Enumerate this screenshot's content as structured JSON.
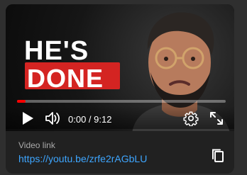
{
  "player": {
    "thumbnail": {
      "line1": "HE'S",
      "line2": "DONE",
      "accent_color": "#d42422"
    },
    "progress": {
      "fraction": 0.04,
      "color": "#ff0000"
    },
    "time": {
      "current": "0:00",
      "separator": " / ",
      "duration": "9:12",
      "display": "0:00 / 9:12"
    },
    "icons": {
      "play": "play-icon",
      "volume": "volume-icon",
      "settings": "gear-icon",
      "fullscreen": "fullscreen-icon"
    }
  },
  "share": {
    "title": "Video link",
    "url": "https://youtu.be/zrfe2rAGbLU",
    "url_color": "#3ea6ff",
    "copy_icon": "copy-icon"
  }
}
